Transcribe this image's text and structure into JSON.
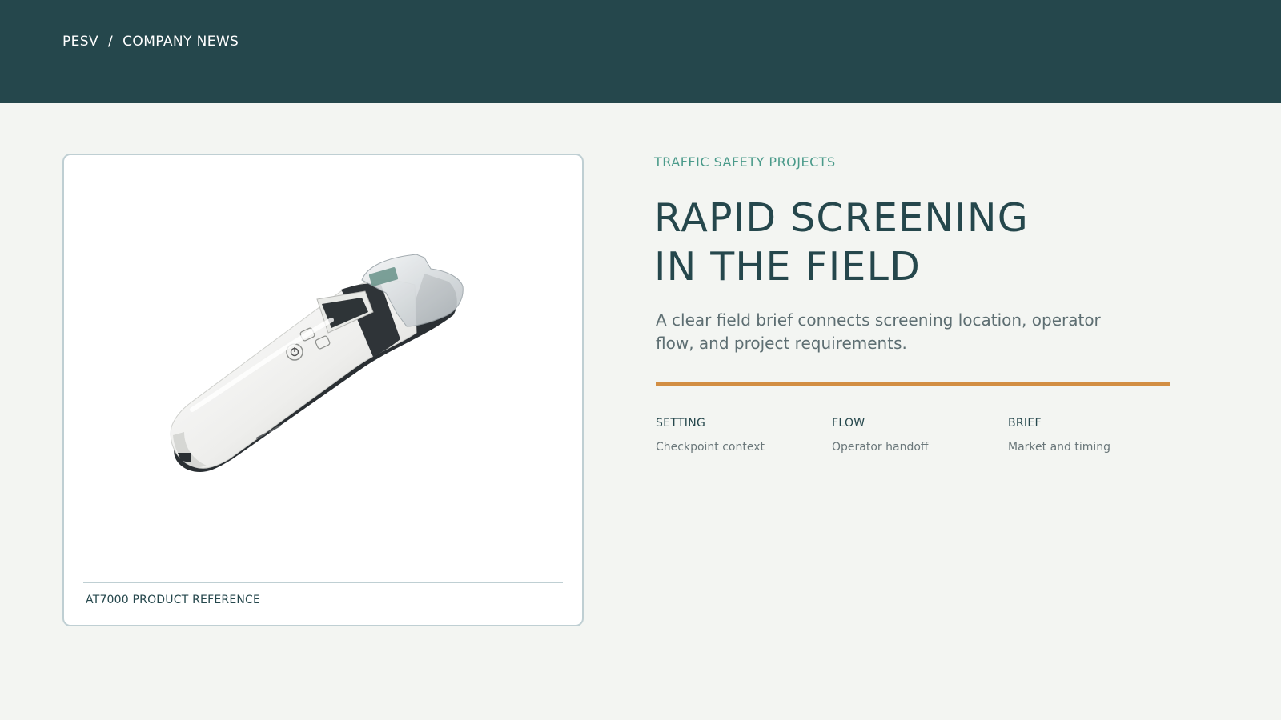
{
  "header": {
    "breadcrumb": {
      "home": "PESV",
      "separator": "/",
      "current": "COMPANY NEWS"
    }
  },
  "product_card": {
    "image_icon": "handheld-breathalyzer-device",
    "caption": "AT7000 PRODUCT REFERENCE"
  },
  "article": {
    "eyebrow": "TRAFFIC SAFETY PROJECTS",
    "headline_line1": "RAPID SCREENING",
    "headline_line2": "IN THE FIELD",
    "lead": "A clear field brief connects screening location, operator flow, and project requirements."
  },
  "facts": [
    {
      "label": "SETTING",
      "value": "Checkpoint context"
    },
    {
      "label": "FLOW",
      "value": "Operator handoff"
    },
    {
      "label": "BRIEF",
      "value": "Market and timing"
    }
  ],
  "colors": {
    "header_bg": "#25474c",
    "page_bg": "#f3f5f2",
    "accent": "#d28e43",
    "eyebrow": "#4a9a8a",
    "text_dark": "#25474c"
  }
}
